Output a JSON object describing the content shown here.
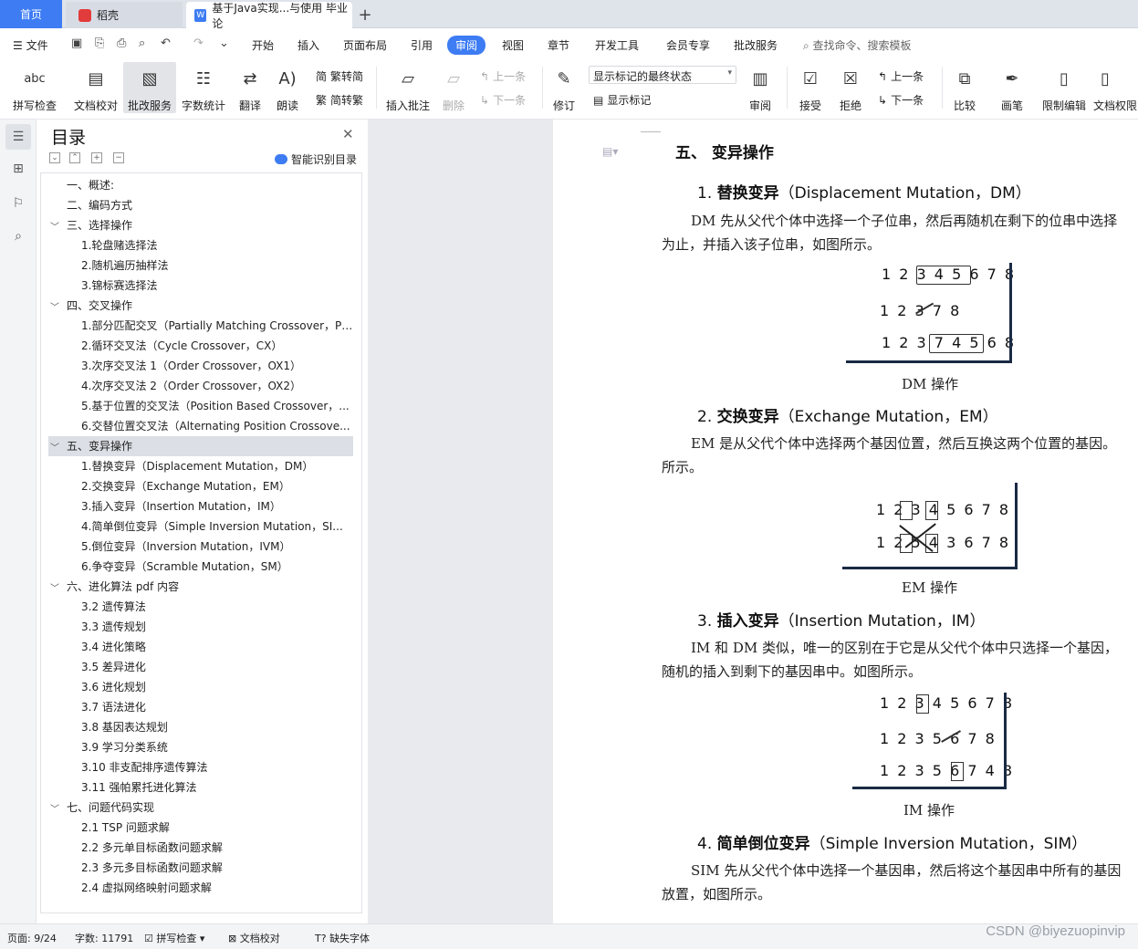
{
  "tabs": {
    "home": "首页",
    "daoke": "稻壳",
    "doc": "基于Java实现...与使用 毕业论",
    "add": "+"
  },
  "menu": {
    "file": "文件",
    "items": [
      "开始",
      "插入",
      "页面布局",
      "引用",
      "审阅",
      "视图",
      "章节",
      "开发工具",
      "会员专享",
      "批改服务"
    ],
    "active": "审阅",
    "search": "查找命令、搜索模板"
  },
  "ribbon": {
    "spell": "拼写检查",
    "doc_check": "文档校对",
    "correction_service": "批改服务",
    "word_count": "字数统计",
    "translate": "翻译",
    "read_aloud": "朗读",
    "trad_to_simp": "繁转简",
    "simp_to_trad": "简转繁",
    "insert_comment": "插入批注",
    "delete": "删除",
    "prev": "上一条",
    "next": "下一条",
    "revise": "修订",
    "markup_state": "显示标记的最终状态",
    "show_markup": "显示标记",
    "review": "审阅",
    "accept": "接受",
    "reject": "拒绝",
    "prev2": "上一条",
    "next2": "下一条",
    "compare": "比较",
    "pen": "画笔",
    "restrict_edit": "限制编辑",
    "doc_permission": "文档权限"
  },
  "panel": {
    "title": "目录",
    "smart_toc": "智能识别目录",
    "toc": [
      {
        "text": "一、概述:",
        "level": 1,
        "chev": ""
      },
      {
        "text": "二、编码方式",
        "level": 1,
        "chev": ""
      },
      {
        "text": "三、选择操作",
        "level": 1,
        "chev": "v"
      },
      {
        "text": "1.轮盘赌选择法",
        "level": 2,
        "chev": ""
      },
      {
        "text": "2.随机遍历抽样法",
        "level": 2,
        "chev": ""
      },
      {
        "text": "3.锦标赛选择法",
        "level": 2,
        "chev": ""
      },
      {
        "text": "四、交叉操作",
        "level": 1,
        "chev": "v"
      },
      {
        "text": "1.部分匹配交叉（Partially Matching Crossover，PM...",
        "level": 2,
        "chev": ""
      },
      {
        "text": "2.循环交叉法（Cycle Crossover，CX）",
        "level": 2,
        "chev": ""
      },
      {
        "text": "3.次序交叉法 1（Order Crossover，OX1）",
        "level": 2,
        "chev": ""
      },
      {
        "text": "4.次序交叉法 2（Order Crossover，OX2）",
        "level": 2,
        "chev": ""
      },
      {
        "text": "5.基于位置的交叉法（Position Based Crossover，...",
        "level": 2,
        "chev": ""
      },
      {
        "text": "6.交替位置交叉法（Alternating Position Crossove...",
        "level": 2,
        "chev": ""
      },
      {
        "text": "五、变异操作",
        "level": 1,
        "chev": "v",
        "selected": true
      },
      {
        "text": "1.替换变异（Displacement Mutation，DM）",
        "level": 2,
        "chev": ""
      },
      {
        "text": "2.交换变异（Exchange Mutation，EM）",
        "level": 2,
        "chev": ""
      },
      {
        "text": "3.插入变异（Insertion Mutation，IM）",
        "level": 2,
        "chev": ""
      },
      {
        "text": "4.简单倒位变异（Simple Inversion Mutation，SI...",
        "level": 2,
        "chev": ""
      },
      {
        "text": "5.倒位变异（Inversion Mutation，IVM）",
        "level": 2,
        "chev": ""
      },
      {
        "text": "6.争夺变异（Scramble Mutation，SM）",
        "level": 2,
        "chev": ""
      },
      {
        "text": "六、进化算法 pdf 内容",
        "level": 1,
        "chev": "v"
      },
      {
        "text": "3.2 遗传算法",
        "level": 2,
        "chev": ""
      },
      {
        "text": "3.3 遗传规划",
        "level": 2,
        "chev": ""
      },
      {
        "text": "3.4 进化策略",
        "level": 2,
        "chev": ""
      },
      {
        "text": "3.5 差异进化",
        "level": 2,
        "chev": ""
      },
      {
        "text": "3.6 进化规划",
        "level": 2,
        "chev": ""
      },
      {
        "text": "3.7 语法进化",
        "level": 2,
        "chev": ""
      },
      {
        "text": "3.8 基因表达规划",
        "level": 2,
        "chev": ""
      },
      {
        "text": "3.9 学习分类系统",
        "level": 2,
        "chev": ""
      },
      {
        "text": "3.10 非支配排序遗传算法",
        "level": 2,
        "chev": ""
      },
      {
        "text": "3.11 强帕累托进化算法",
        "level": 2,
        "chev": ""
      },
      {
        "text": "七、问题代码实现",
        "level": 1,
        "chev": "v"
      },
      {
        "text": "2.1 TSP 问题求解",
        "level": 2,
        "chev": ""
      },
      {
        "text": "2.2 多元单目标函数问题求解",
        "level": 2,
        "chev": ""
      },
      {
        "text": "2.3 多元多目标函数问题求解",
        "level": 2,
        "chev": ""
      },
      {
        "text": "2.4 虚拟网络映射问题求解",
        "level": 2,
        "chev": ""
      }
    ]
  },
  "doc": {
    "h1": "五、 变异操作",
    "dm_num": "1.",
    "dm_title_cn": "替换变异",
    "dm_title_en": "（Displacement Mutation，DM）",
    "dm_p1": "DM 先从父代个体中选择一个子位串，然后再随机在剩下的位串中选择",
    "dm_p2": "为止，并插入该子位串，如图所示。",
    "dm_fig": [
      "1 2 3 4 5 6 7 8",
      "1 2 3 7 8",
      "1 2 3 7 4 5 6 8"
    ],
    "dm_cap": "DM 操作",
    "em_num": "2.",
    "em_title_cn": "交换变异",
    "em_title_en": "（Exchange Mutation，EM）",
    "em_p1": "EM 是从父代个体中选择两个基因位置，然后互换这两个位置的基因。",
    "em_p2": "所示。",
    "em_fig": [
      "1 2 3 4 5 6 7 8",
      "1 2 5 4 3 6 7 8"
    ],
    "em_cap": "EM 操作",
    "im_num": "3.",
    "im_title_cn": "插入变异",
    "im_title_en": "（Insertion Mutation，IM）",
    "im_p1": "IM 和 DM 类似，唯一的区别在于它是从父代个体中只选择一个基因，",
    "im_p2": "随机的插入到剩下的基因串中。如图所示。",
    "im_fig": [
      "1 2 3 4 5 6 7 8",
      "1 2 3 5 6 7 8",
      "1 2 3 5 6 7 4 8"
    ],
    "im_cap": "IM 操作",
    "sim_num": "4.",
    "sim_title_cn": "简单倒位变异",
    "sim_title_en": "（Simple Inversion Mutation，SIM）",
    "sim_p1": "SIM 先从父代个体中选择一个基因串，然后将这个基因串中所有的基因",
    "sim_p2": "放置，如图所示。"
  },
  "status": {
    "page": "页面: 9/24",
    "words": "字数: 11791",
    "spell": "拼写检查",
    "doc_check": "文档校对",
    "missing_font": "缺失字体",
    "watermark": "CSDN @biyezuopinvip"
  }
}
